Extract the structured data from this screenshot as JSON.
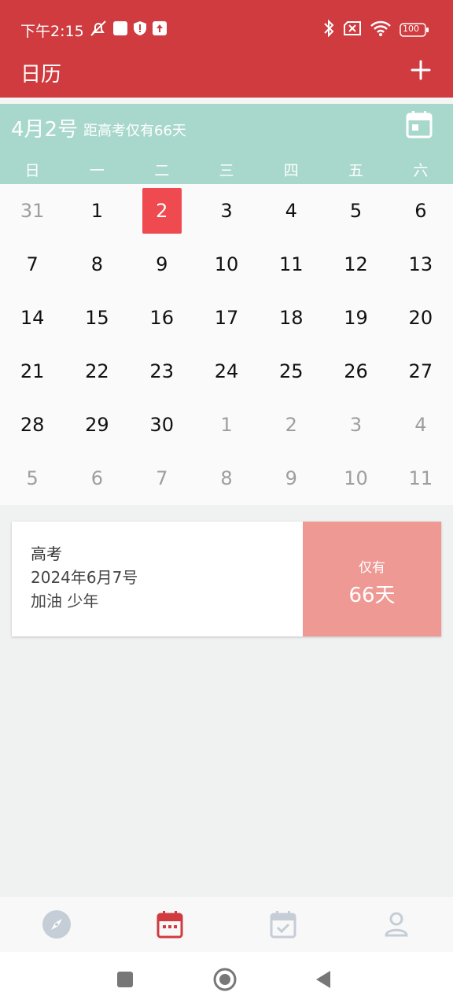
{
  "status": {
    "time": "下午2:15",
    "battery": "100"
  },
  "app": {
    "title": "日历"
  },
  "calendar": {
    "date_label": "4月2号",
    "countdown_label": "距高考仅有66天",
    "weekdays": [
      "日",
      "一",
      "二",
      "三",
      "四",
      "五",
      "六"
    ],
    "weeks": [
      [
        "31",
        "1",
        "2",
        "3",
        "4",
        "5",
        "6"
      ],
      [
        "7",
        "8",
        "9",
        "10",
        "11",
        "12",
        "13"
      ],
      [
        "14",
        "15",
        "16",
        "17",
        "18",
        "19",
        "20"
      ],
      [
        "21",
        "22",
        "23",
        "24",
        "25",
        "26",
        "27"
      ],
      [
        "28",
        "29",
        "30",
        "1",
        "2",
        "3",
        "4"
      ],
      [
        "5",
        "6",
        "7",
        "8",
        "9",
        "10",
        "11"
      ]
    ],
    "selected_day": "2"
  },
  "event": {
    "title": "高考",
    "date": "2024年6月7号",
    "note": "加油 少年",
    "remaining_label": "仅有",
    "remaining_days": "66天"
  },
  "icons": {
    "add": "plus-icon",
    "calendar": "calendar-icon",
    "nav": [
      "compass-icon",
      "calendar-icon",
      "task-check-icon",
      "person-icon"
    ]
  },
  "colors": {
    "primary": "#cf3b3f",
    "header": "#a8d8cb",
    "selected": "#ef4a50",
    "event_side": "#ef9995",
    "nav_active": "#cf3b3f",
    "nav_inactive": "#c5cdd6"
  }
}
